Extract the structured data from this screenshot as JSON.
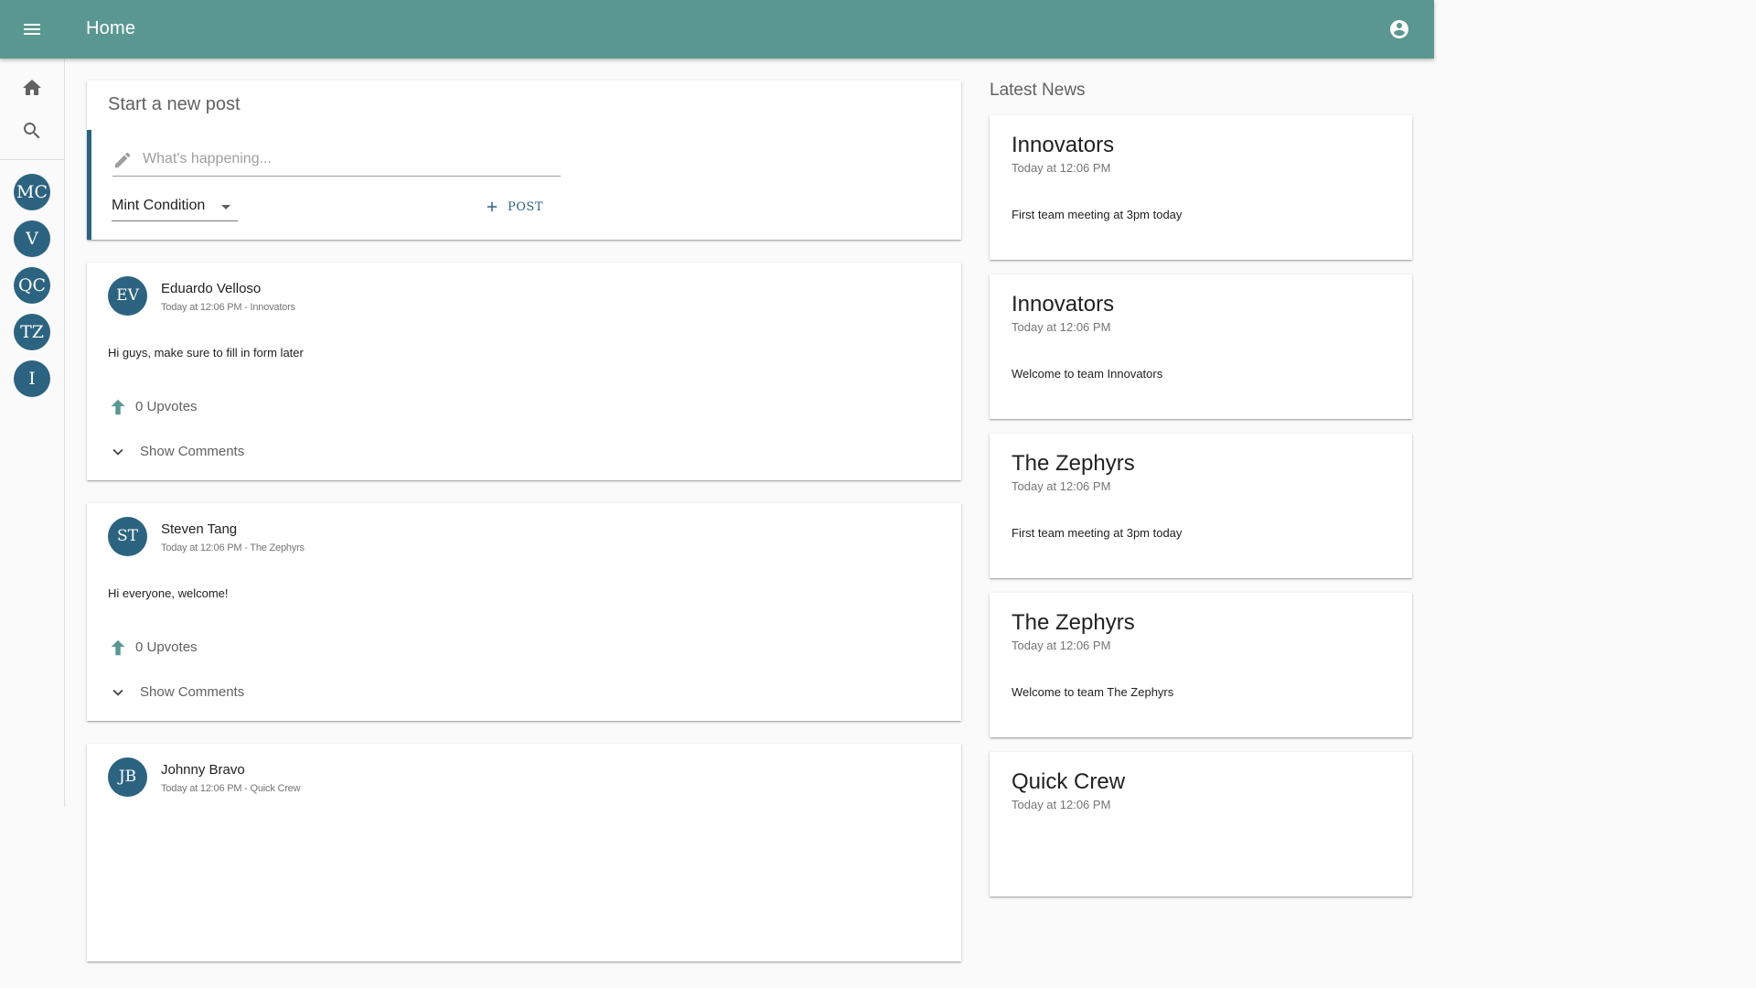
{
  "app_bar": {
    "title": "Home",
    "color": "#5a9790",
    "menu_icon": "menu-icon",
    "account_icon": "account-circle-icon"
  },
  "rail": {
    "nav": [
      {
        "name": "home",
        "icon": "home-icon"
      },
      {
        "name": "search",
        "icon": "search-icon"
      }
    ],
    "teams": [
      {
        "initials": "MC"
      },
      {
        "initials": "V"
      },
      {
        "initials": "QC"
      },
      {
        "initials": "TZ"
      },
      {
        "initials": "I"
      }
    ]
  },
  "composer": {
    "heading": "Start a new post",
    "placeholder": "What's happening...",
    "selected_team": "Mint Condition",
    "post_label": "POST"
  },
  "posts": [
    {
      "initials": "EV",
      "author": "Eduardo Velloso",
      "meta": "Today at 12:06 PM - Innovators",
      "body": "Hi guys, make sure to fill in form later",
      "upvotes": "0 Upvotes",
      "comments_label": "Show Comments"
    },
    {
      "initials": "ST",
      "author": "Steven Tang",
      "meta": "Today at 12:06 PM - The Zephyrs",
      "body": "Hi everyone, welcome!",
      "upvotes": "0 Upvotes",
      "comments_label": "Show Comments"
    },
    {
      "initials": "JB",
      "author": "Johnny Bravo",
      "meta": "Today at 12:06 PM - Quick Crew",
      "body": "",
      "upvotes": "",
      "comments_label": ""
    }
  ],
  "news": {
    "heading": "Latest News",
    "items": [
      {
        "team": "Innovators",
        "time": "Today at 12:06 PM",
        "message": "First team meeting at 3pm today"
      },
      {
        "team": "Innovators",
        "time": "Today at 12:06 PM",
        "message": "Welcome to team Innovators"
      },
      {
        "team": "The Zephyrs",
        "time": "Today at 12:06 PM",
        "message": "First team meeting at 3pm today"
      },
      {
        "team": "The Zephyrs",
        "time": "Today at 12:06 PM",
        "message": "Welcome to team The Zephyrs"
      },
      {
        "team": "Quick Crew",
        "time": "Today at 12:06 PM",
        "message": ""
      }
    ]
  },
  "colors": {
    "primary": "#5a9790",
    "avatar": "#2c6380",
    "upvote": "#5a9790"
  }
}
